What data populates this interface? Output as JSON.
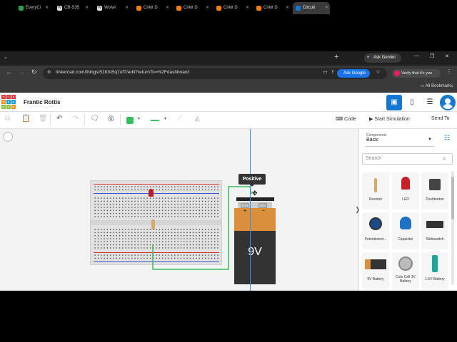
{
  "browser": {
    "tabs": [
      {
        "label": "EveryCi",
        "color": "#2e9e4f"
      },
      {
        "label": "CB-S35",
        "color": "#e8e8e8"
      },
      {
        "label": "Wolwi",
        "color": "#e8e8e8"
      },
      {
        "label": "Cirkit D",
        "color": "#f57c00"
      },
      {
        "label": "Cirkit D",
        "color": "#f57c00"
      },
      {
        "label": "Cirkit D",
        "color": "#f57c00"
      },
      {
        "label": "Cirkit D",
        "color": "#f57c00"
      },
      {
        "label": "Circuit",
        "color": "#1477d1"
      }
    ],
    "new_tab": "+",
    "ask_gemini": "Ask Gemini",
    "url": "tinkercad.com/things/51KhlSq7ofT/edit?returnTo=%2Fdashboard",
    "ask_google": "Ask Google",
    "verify": "Verify that it's you",
    "all_bookmarks": "All Bookmarks"
  },
  "tinkercad": {
    "logo_letters": [
      "TIN",
      "KER",
      "CAD"
    ],
    "logo_colors": [
      "#e03a3e",
      "#f7941d",
      "#1ca0d6",
      "#8cc63f"
    ],
    "project_title": "Frantic Rottis"
  },
  "toolbar": {
    "code_label": "Code",
    "start_sim_label": "Start Simulation",
    "send_to_label": "Send To",
    "wire_color": "#34c05a"
  },
  "canvas": {
    "tooltip": "Positive",
    "battery_label": "9V",
    "battery_plus": "+",
    "battery_minus": "−",
    "wire_color": "#34c05a"
  },
  "components_panel": {
    "label": "Components",
    "selected": "Basic",
    "search_placeholder": "Search",
    "items": [
      {
        "name": "Resistor"
      },
      {
        "name": "LED"
      },
      {
        "name": "Pushbutton"
      },
      {
        "name": "Potentiomet..."
      },
      {
        "name": "Capacitor"
      },
      {
        "name": "Slideswitch"
      },
      {
        "name": "9V Battery"
      },
      {
        "name": "Coin Cell 3V Battery"
      },
      {
        "name": "1.5V Battery"
      }
    ]
  }
}
